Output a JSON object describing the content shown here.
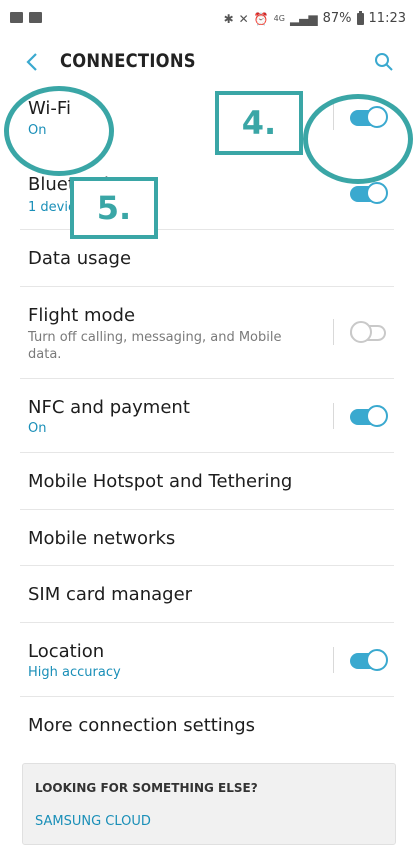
{
  "status_bar": {
    "battery": "87%",
    "time": "11:23",
    "network_small": "4G"
  },
  "header": {
    "title": "CONNECTIONS",
    "back_icon": "chevron-left-icon",
    "search_icon": "search-icon"
  },
  "rows": [
    {
      "label": "Wi-Fi",
      "sub": "On",
      "toggle": "on"
    },
    {
      "label": "Bluetooth",
      "sub": "1 device",
      "toggle": "on"
    },
    {
      "label": "Data usage"
    },
    {
      "label": "Flight mode",
      "sub": "Turn off calling, messaging, and Mobile data.",
      "toggle": "off"
    },
    {
      "label": "NFC and payment",
      "sub": "On",
      "toggle": "on"
    },
    {
      "label": "Mobile Hotspot and Tethering"
    },
    {
      "label": "Mobile networks"
    },
    {
      "label": "SIM card manager"
    },
    {
      "label": "Location",
      "sub": "High accuracy",
      "toggle": "on"
    },
    {
      "label": "More connection settings"
    }
  ],
  "card": {
    "title": "LOOKING FOR SOMETHING ELSE?",
    "link": "SAMSUNG CLOUD"
  },
  "annotations": {
    "box_4": "4.",
    "box_5": "5."
  },
  "colors": {
    "accent": "#3aa9cf",
    "annotation": "#3aa6a6",
    "sub_text": "#1a8fb8"
  }
}
